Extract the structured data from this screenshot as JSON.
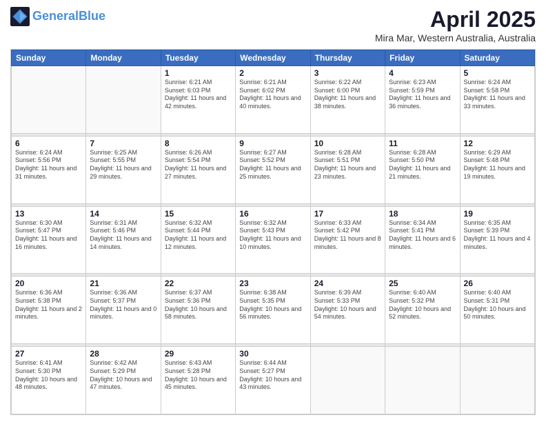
{
  "logo": {
    "line1": "General",
    "line2": "Blue"
  },
  "title": "April 2025",
  "subtitle": "Mira Mar, Western Australia, Australia",
  "days_of_week": [
    "Sunday",
    "Monday",
    "Tuesday",
    "Wednesday",
    "Thursday",
    "Friday",
    "Saturday"
  ],
  "weeks": [
    [
      {
        "day": "",
        "info": ""
      },
      {
        "day": "",
        "info": ""
      },
      {
        "day": "1",
        "info": "Sunrise: 6:21 AM\nSunset: 6:03 PM\nDaylight: 11 hours and 42 minutes."
      },
      {
        "day": "2",
        "info": "Sunrise: 6:21 AM\nSunset: 6:02 PM\nDaylight: 11 hours and 40 minutes."
      },
      {
        "day": "3",
        "info": "Sunrise: 6:22 AM\nSunset: 6:00 PM\nDaylight: 11 hours and 38 minutes."
      },
      {
        "day": "4",
        "info": "Sunrise: 6:23 AM\nSunset: 5:59 PM\nDaylight: 11 hours and 36 minutes."
      },
      {
        "day": "5",
        "info": "Sunrise: 6:24 AM\nSunset: 5:58 PM\nDaylight: 11 hours and 33 minutes."
      }
    ],
    [
      {
        "day": "6",
        "info": "Sunrise: 6:24 AM\nSunset: 5:56 PM\nDaylight: 11 hours and 31 minutes."
      },
      {
        "day": "7",
        "info": "Sunrise: 6:25 AM\nSunset: 5:55 PM\nDaylight: 11 hours and 29 minutes."
      },
      {
        "day": "8",
        "info": "Sunrise: 6:26 AM\nSunset: 5:54 PM\nDaylight: 11 hours and 27 minutes."
      },
      {
        "day": "9",
        "info": "Sunrise: 6:27 AM\nSunset: 5:52 PM\nDaylight: 11 hours and 25 minutes."
      },
      {
        "day": "10",
        "info": "Sunrise: 6:28 AM\nSunset: 5:51 PM\nDaylight: 11 hours and 23 minutes."
      },
      {
        "day": "11",
        "info": "Sunrise: 6:28 AM\nSunset: 5:50 PM\nDaylight: 11 hours and 21 minutes."
      },
      {
        "day": "12",
        "info": "Sunrise: 6:29 AM\nSunset: 5:48 PM\nDaylight: 11 hours and 19 minutes."
      }
    ],
    [
      {
        "day": "13",
        "info": "Sunrise: 6:30 AM\nSunset: 5:47 PM\nDaylight: 11 hours and 16 minutes."
      },
      {
        "day": "14",
        "info": "Sunrise: 6:31 AM\nSunset: 5:46 PM\nDaylight: 11 hours and 14 minutes."
      },
      {
        "day": "15",
        "info": "Sunrise: 6:32 AM\nSunset: 5:44 PM\nDaylight: 11 hours and 12 minutes."
      },
      {
        "day": "16",
        "info": "Sunrise: 6:32 AM\nSunset: 5:43 PM\nDaylight: 11 hours and 10 minutes."
      },
      {
        "day": "17",
        "info": "Sunrise: 6:33 AM\nSunset: 5:42 PM\nDaylight: 11 hours and 8 minutes."
      },
      {
        "day": "18",
        "info": "Sunrise: 6:34 AM\nSunset: 5:41 PM\nDaylight: 11 hours and 6 minutes."
      },
      {
        "day": "19",
        "info": "Sunrise: 6:35 AM\nSunset: 5:39 PM\nDaylight: 11 hours and 4 minutes."
      }
    ],
    [
      {
        "day": "20",
        "info": "Sunrise: 6:36 AM\nSunset: 5:38 PM\nDaylight: 11 hours and 2 minutes."
      },
      {
        "day": "21",
        "info": "Sunrise: 6:36 AM\nSunset: 5:37 PM\nDaylight: 11 hours and 0 minutes."
      },
      {
        "day": "22",
        "info": "Sunrise: 6:37 AM\nSunset: 5:36 PM\nDaylight: 10 hours and 58 minutes."
      },
      {
        "day": "23",
        "info": "Sunrise: 6:38 AM\nSunset: 5:35 PM\nDaylight: 10 hours and 56 minutes."
      },
      {
        "day": "24",
        "info": "Sunrise: 6:39 AM\nSunset: 5:33 PM\nDaylight: 10 hours and 54 minutes."
      },
      {
        "day": "25",
        "info": "Sunrise: 6:40 AM\nSunset: 5:32 PM\nDaylight: 10 hours and 52 minutes."
      },
      {
        "day": "26",
        "info": "Sunrise: 6:40 AM\nSunset: 5:31 PM\nDaylight: 10 hours and 50 minutes."
      }
    ],
    [
      {
        "day": "27",
        "info": "Sunrise: 6:41 AM\nSunset: 5:30 PM\nDaylight: 10 hours and 48 minutes."
      },
      {
        "day": "28",
        "info": "Sunrise: 6:42 AM\nSunset: 5:29 PM\nDaylight: 10 hours and 47 minutes."
      },
      {
        "day": "29",
        "info": "Sunrise: 6:43 AM\nSunset: 5:28 PM\nDaylight: 10 hours and 45 minutes."
      },
      {
        "day": "30",
        "info": "Sunrise: 6:44 AM\nSunset: 5:27 PM\nDaylight: 10 hours and 43 minutes."
      },
      {
        "day": "",
        "info": ""
      },
      {
        "day": "",
        "info": ""
      },
      {
        "day": "",
        "info": ""
      }
    ]
  ]
}
